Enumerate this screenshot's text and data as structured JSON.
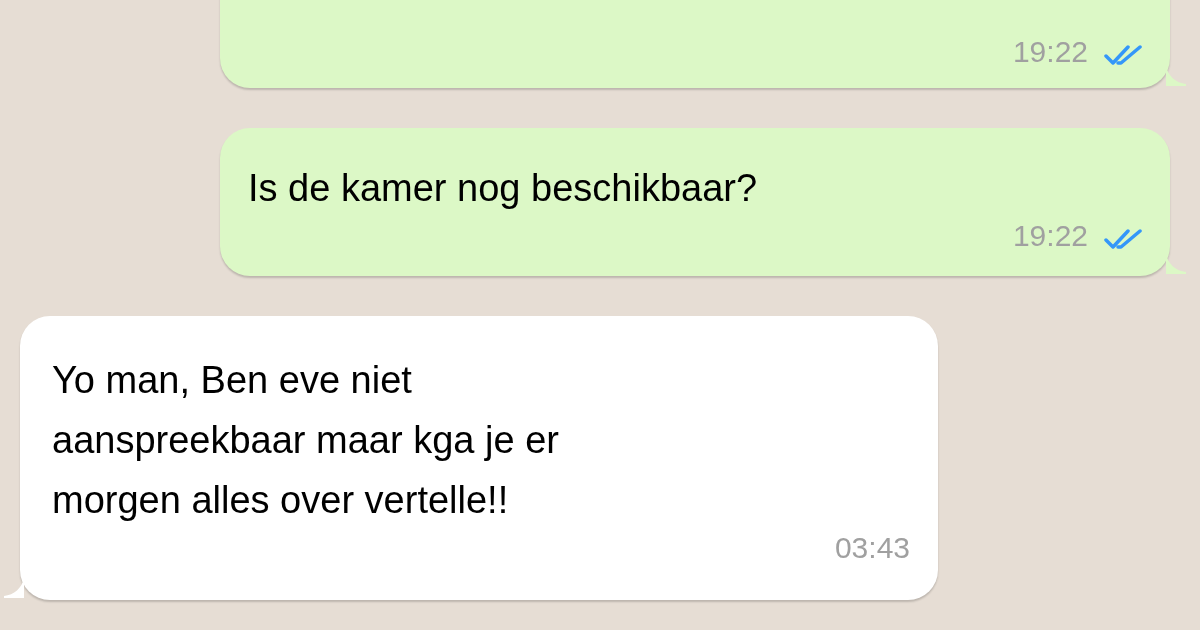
{
  "messages": [
    {
      "kind": "outgoing",
      "time": "19:22",
      "read": true
    },
    {
      "kind": "outgoing",
      "text": "Is de kamer nog beschikbaar?",
      "time": "19:22",
      "read": true
    },
    {
      "kind": "incoming",
      "text": "Yo man, Ben eve niet\naanspreekbaar maar kga je er\nmorgen alles over vertelle!!",
      "time": "03:43"
    }
  ]
}
